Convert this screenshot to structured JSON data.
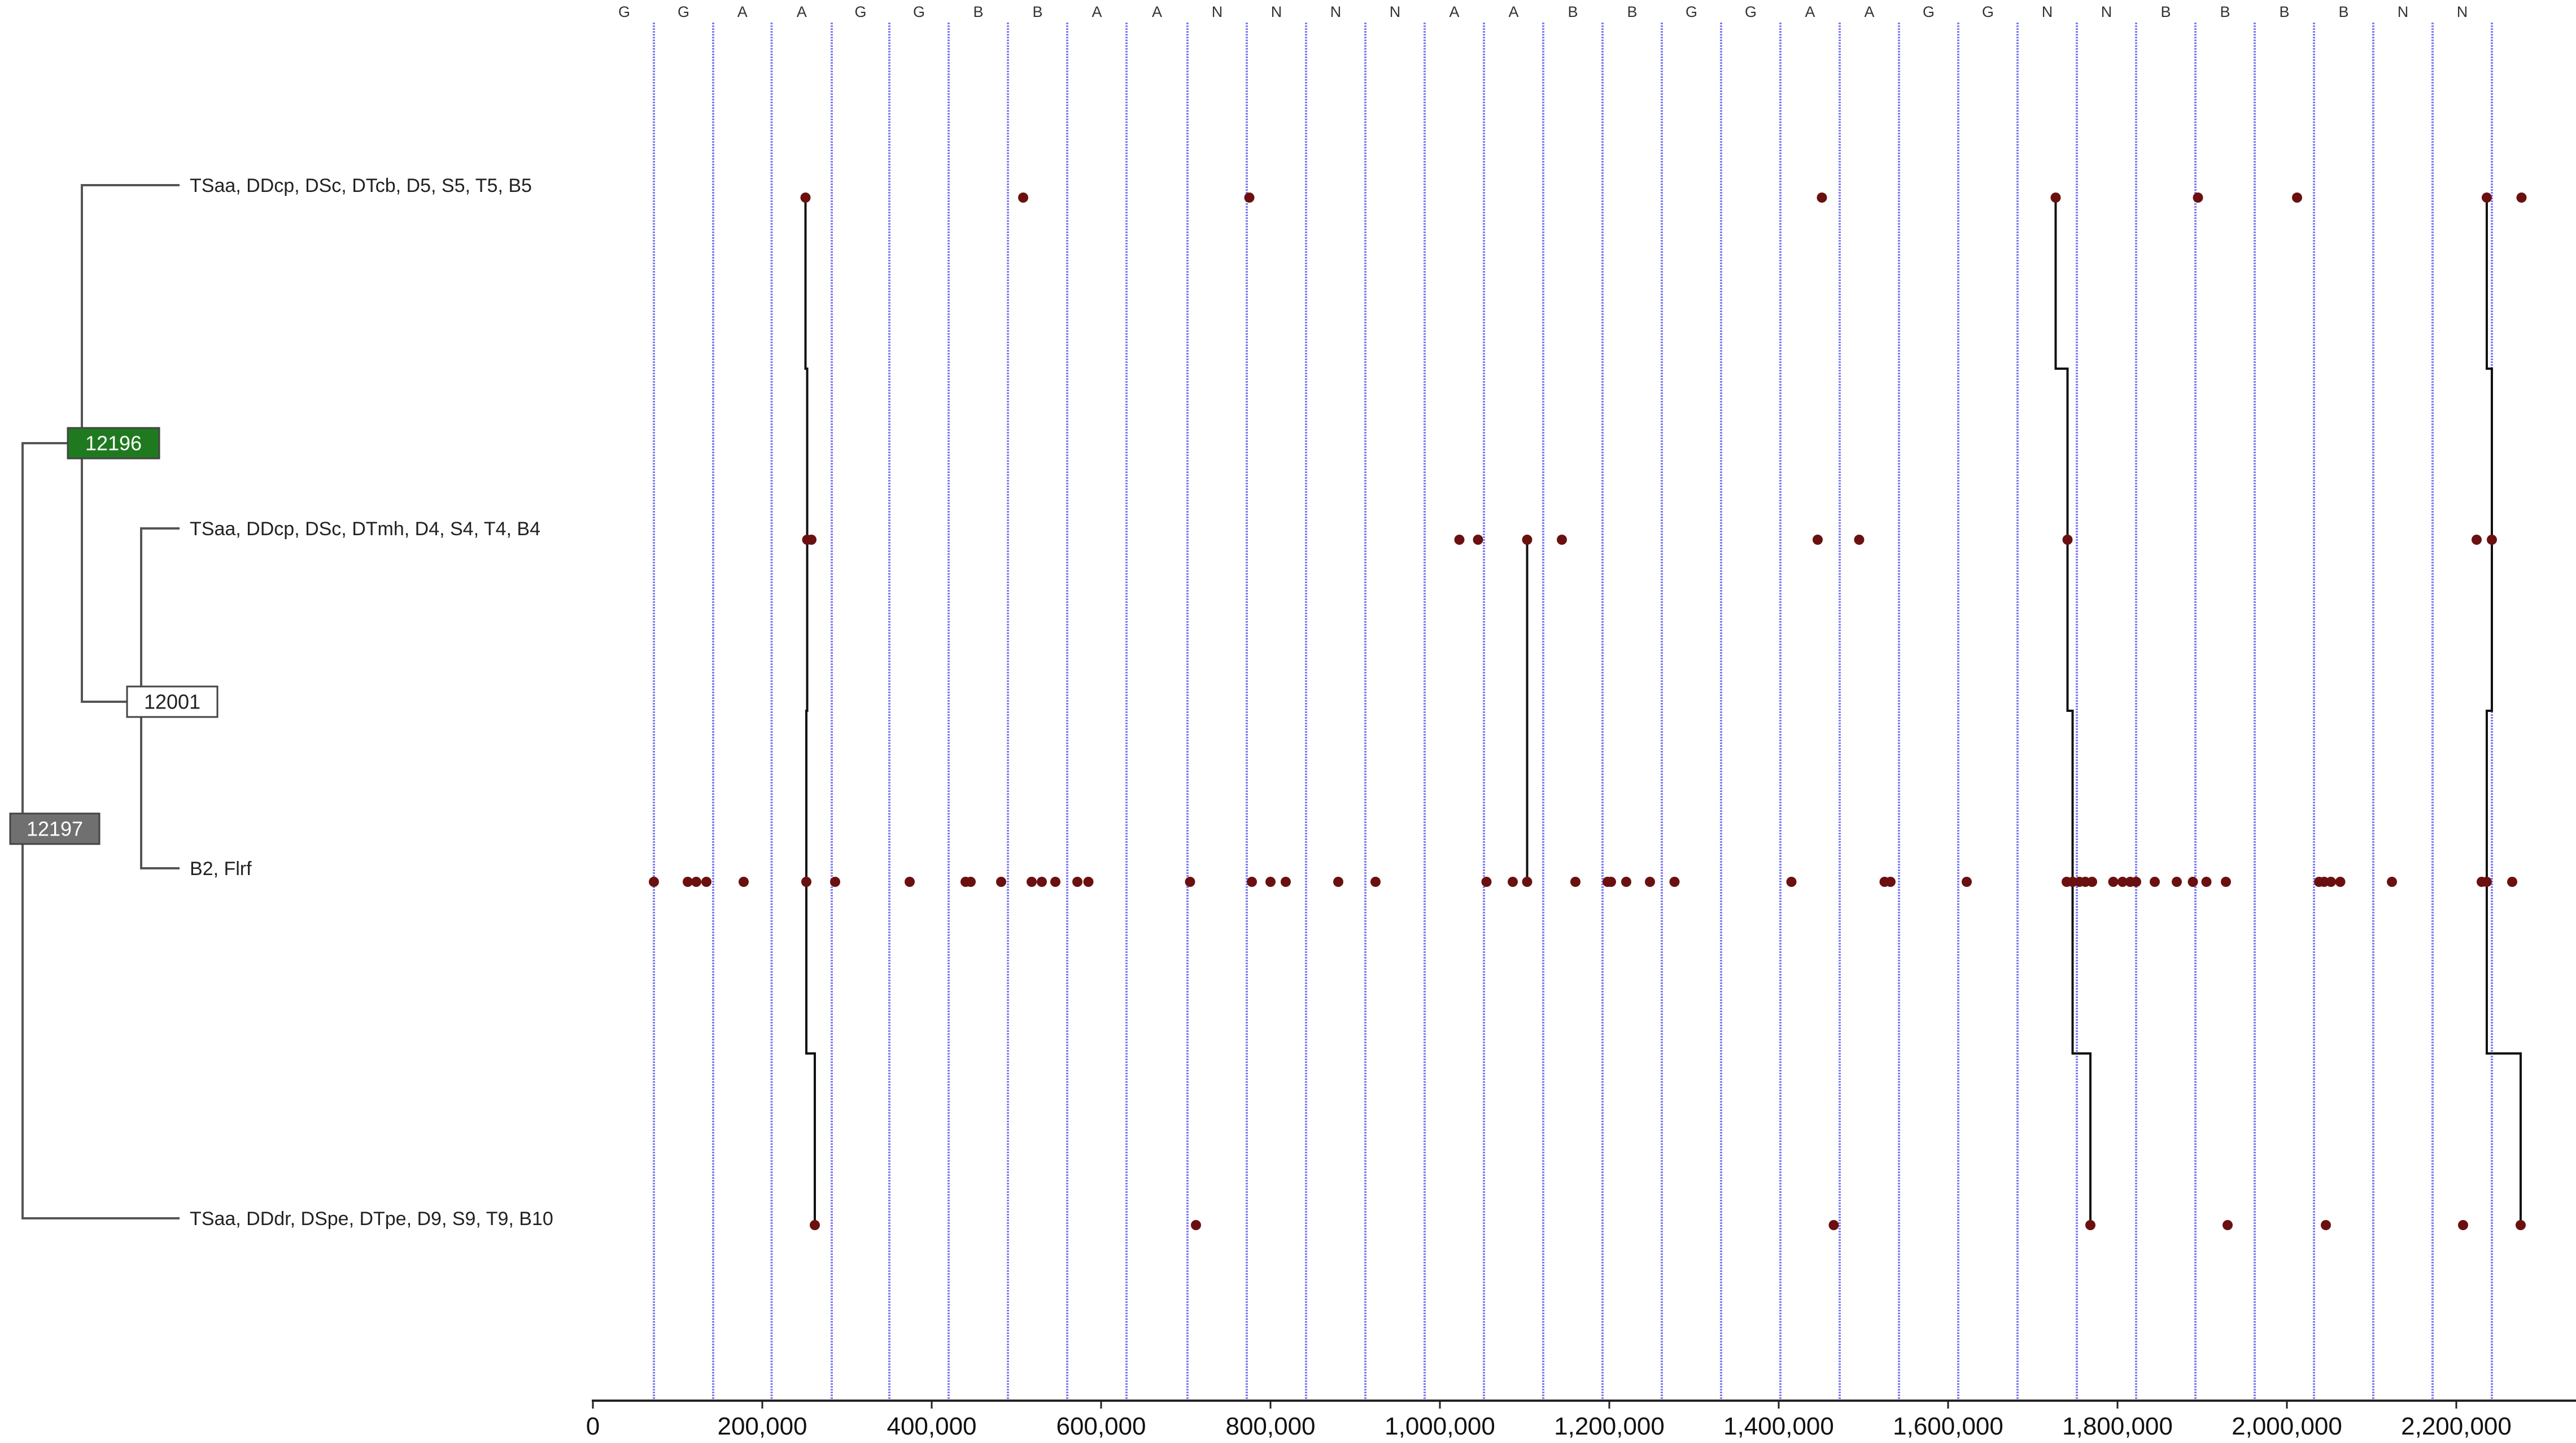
{
  "tree": {
    "nodes": [
      {
        "id": "12196",
        "label": "12196",
        "fill": "#1f7a1f",
        "text_color": "#ffffff"
      },
      {
        "id": "12001",
        "label": "12001",
        "fill": "#ffffff",
        "text_color": "#222222"
      },
      {
        "id": "12197",
        "label": "12197",
        "fill": "#707070",
        "text_color": "#ffffff"
      }
    ],
    "leaves": [
      {
        "id": "leaf1",
        "label": "TSaa, DDcp, DSc, DTcb, D5, S5, T5, B5"
      },
      {
        "id": "leaf2",
        "label": "TSaa, DDcp, DSc, DTmh, D4, S4, T4, B4"
      },
      {
        "id": "leaf3",
        "label": "B2, Flrf"
      },
      {
        "id": "leaf4",
        "label": "TSaa, DDdr, DSpe, DTpe, D9, S9, T9, B10"
      }
    ]
  },
  "chart_data": {
    "type": "scatter",
    "title": "",
    "xlabel": "",
    "ylabel": "",
    "xlim": [
      0,
      2280000
    ],
    "x_ticks": [
      0,
      200000,
      400000,
      600000,
      800000,
      1000000,
      1200000,
      1400000,
      1600000,
      1800000,
      2000000,
      2200000
    ],
    "x_tick_labels": [
      "0",
      "200,000",
      "400,000",
      "600,000",
      "800,000",
      "1,000,000",
      "1,200,000",
      "1,400,000",
      "1,600,000",
      "1,800,000",
      "2,000,000",
      "2,200,000"
    ],
    "grid": true,
    "dot_color": "#6b1010",
    "line_color": "#111111",
    "separator_color": "#7f7ff2",
    "category_separators": [
      72000,
      142000,
      211000,
      282000,
      350000,
      420000,
      490000,
      560000,
      630000,
      702000,
      772000,
      842000,
      912000,
      982000,
      1052000,
      1122000,
      1192000,
      1262000,
      1332000,
      1402000,
      1472000,
      1542000,
      1612000,
      1682000,
      1752000,
      1822000,
      1892000,
      1962000,
      2032000,
      2102000,
      2172000,
      2242000
    ],
    "category_labels": [
      "G",
      "G",
      "A",
      "A",
      "G",
      "G",
      "B",
      "B",
      "A",
      "A",
      "N",
      "N",
      "N",
      "N",
      "A",
      "A",
      "B",
      "B",
      "G",
      "G",
      "A",
      "A",
      "G",
      "G",
      "N",
      "N",
      "B",
      "B",
      "B",
      "B",
      "N",
      "N"
    ],
    "rows": [
      {
        "leaf": "leaf1",
        "x": [
          251000,
          508000,
          775000,
          1451000,
          1727000,
          1895000,
          2012000,
          2236000,
          2277000
        ]
      },
      {
        "leaf": "leaf2",
        "x": [
          253000,
          258000,
          1023000,
          1045000,
          1103000,
          1144000,
          1446000,
          1495000,
          1741000,
          2224000,
          2242000
        ]
      },
      {
        "leaf": "leaf3",
        "x": [
          72000,
          112000,
          122000,
          134000,
          178000,
          252000,
          286000,
          374000,
          440000,
          446000,
          482000,
          518000,
          530000,
          546000,
          572000,
          585000,
          705000,
          778000,
          800000,
          818000,
          880000,
          924000,
          1055000,
          1086000,
          1103000,
          1160000,
          1198000,
          1202000,
          1220000,
          1248000,
          1277000,
          1415000,
          1525000,
          1532000,
          1622000,
          1740000,
          1747000,
          1755000,
          1762000,
          1770000,
          1795000,
          1806000,
          1815000,
          1822000,
          1844000,
          1870000,
          1889000,
          1905000,
          1928000,
          2038000,
          2044000,
          2052000,
          2063000,
          2124000,
          2230000,
          2236000,
          2266000
        ]
      },
      {
        "leaf": "leaf4",
        "x": [
          262000,
          712000,
          1465000,
          1768000,
          1930000,
          2046000,
          2208000,
          2276000
        ]
      }
    ],
    "connectors": [
      {
        "rows": [
          "leaf1",
          "leaf2",
          "leaf3",
          "leaf4"
        ],
        "x": [
          251000,
          253000,
          252000,
          262000
        ]
      },
      {
        "rows": [
          "leaf2",
          "leaf3"
        ],
        "x": [
          1103000,
          1103000
        ]
      },
      {
        "rows": [
          "leaf1",
          "leaf2",
          "leaf3",
          "leaf4"
        ],
        "x": [
          1727000,
          1741000,
          1747000,
          1768000
        ]
      },
      {
        "rows": [
          "leaf1",
          "leaf2",
          "leaf3",
          "leaf4"
        ],
        "x": [
          2236000,
          2242000,
          2236000,
          2276000
        ]
      }
    ]
  }
}
